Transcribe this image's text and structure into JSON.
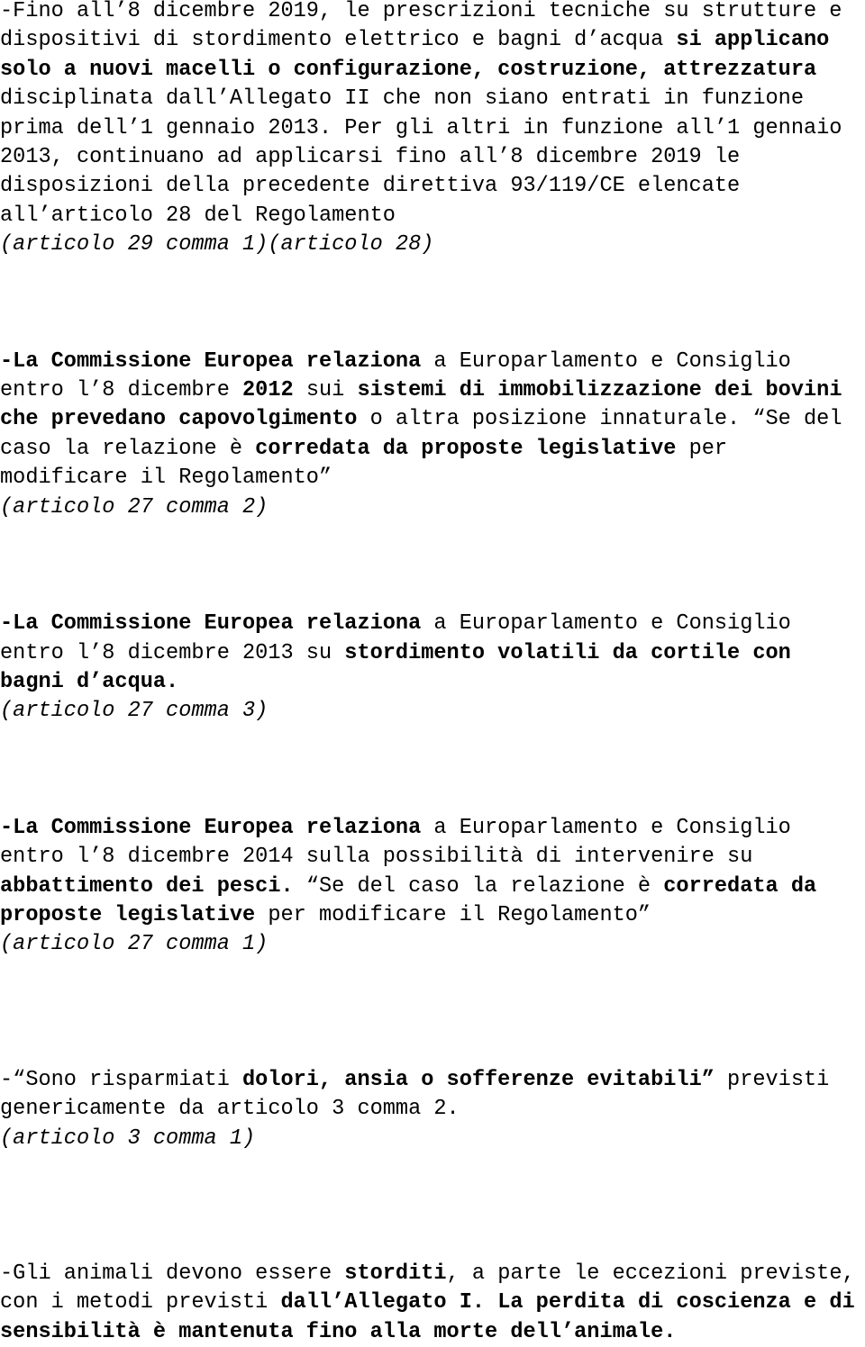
{
  "document": {
    "language": "it",
    "background_color": "#ffffff",
    "text_color": "#000000",
    "blocks": [
      {
        "id": "block-1",
        "type": "paragraph",
        "runs": [
          {
            "text": "-Fino all’8 dicembre 2019, le prescrizioni tecniche su strutture e dispositivi di stordimento elettrico e bagni d’acqua ",
            "bold": false
          },
          {
            "text": "si applicano solo a nuovi macelli o configurazione, costruzione, attrezzatura",
            "bold": true
          },
          {
            "text": " disciplinata dall’Allegato II che non siano entrati in funzione prima dell’1 gennaio 2013. Per gli altri in funzione all’1 gennaio 2013, continuano ad applicarsi fino all’8 dicembre 2019 le disposizioni della precedente direttiva 93/119/CE elencate all’articolo 28 del Regolamento",
            "bold": false
          }
        ]
      },
      {
        "id": "citation-1",
        "type": "citation",
        "text": "(articolo 29 comma 1)(articolo 28)"
      },
      {
        "id": "block-2",
        "type": "paragraph",
        "runs": [
          {
            "text": "-La Commissione Europea relaziona",
            "bold": true
          },
          {
            "text": " a Europarlamento e Consiglio entro l’8 dicembre ",
            "bold": false
          },
          {
            "text": "2012",
            "bold": true
          },
          {
            "text": " sui ",
            "bold": false
          },
          {
            "text": "sistemi di immobilizzazione dei bovini che prevedano capovolgimento",
            "bold": true
          },
          {
            "text": " o altra posizione innaturale. “Se del caso la relazione è ",
            "bold": false
          },
          {
            "text": "corredata da proposte legislative",
            "bold": true
          },
          {
            "text": " per modificare il Regolamento”",
            "bold": false
          }
        ]
      },
      {
        "id": "citation-2",
        "type": "citation",
        "text": "(articolo 27 comma 2)"
      },
      {
        "id": "block-3",
        "type": "paragraph",
        "runs": [
          {
            "text": "-La Commissione Europea relaziona",
            "bold": true
          },
          {
            "text": " a Europarlamento e Consiglio entro l’8 dicembre 2013 su ",
            "bold": false
          },
          {
            "text": "stordimento volatili da cortile con bagni d’acqua.",
            "bold": true
          }
        ]
      },
      {
        "id": "citation-3",
        "type": "citation",
        "text": "(articolo 27 comma 3)"
      },
      {
        "id": "block-4",
        "type": "paragraph",
        "runs": [
          {
            "text": "-La Commissione Europea relaziona",
            "bold": true
          },
          {
            "text": " a Europarlamento e Consiglio entro l’8 dicembre 2014 sulla possibilità di intervenire su ",
            "bold": false
          },
          {
            "text": "abbattimento dei pesci.",
            "bold": true
          },
          {
            "text": " “Se del caso la relazione è ",
            "bold": false
          },
          {
            "text": "corredata da proposte legislative",
            "bold": true
          },
          {
            "text": " per modificare il Regolamento”",
            "bold": false
          }
        ]
      },
      {
        "id": "citation-4",
        "type": "citation",
        "text": "(articolo 27 comma 1)"
      },
      {
        "id": "block-5",
        "type": "paragraph",
        "runs": [
          {
            "text": "-“Sono risparmiati ",
            "bold": false
          },
          {
            "text": "dolori, ansia o sofferenze evitabili”",
            "bold": true
          },
          {
            "text": " previsti genericamente da articolo 3 comma 2.",
            "bold": false
          }
        ]
      },
      {
        "id": "citation-5",
        "type": "citation",
        "text": "(articolo 3 comma 1)"
      },
      {
        "id": "block-6",
        "type": "paragraph",
        "runs": [
          {
            "text": "-Gli animali devono essere ",
            "bold": false
          },
          {
            "text": "storditi",
            "bold": true
          },
          {
            "text": ", a parte le eccezioni previste, con i metodi previsti ",
            "bold": false
          },
          {
            "text": "dall’Allegato I. La perdita di coscienza e di sensibilità è mantenuta fino alla morte dell’animale.",
            "bold": true
          }
        ]
      }
    ]
  }
}
